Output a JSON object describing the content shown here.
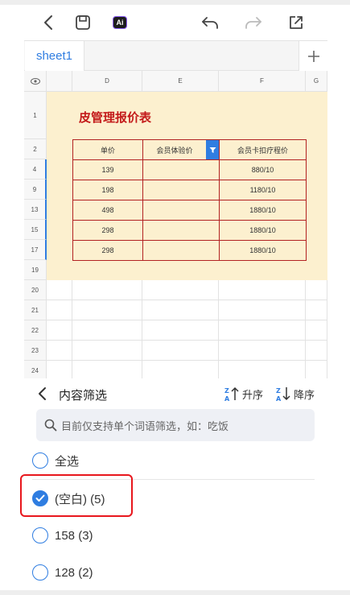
{
  "sheet_tab": "sheet1",
  "columns": [
    "D",
    "E",
    "F",
    "G"
  ],
  "rows_top": [
    "1",
    "2",
    "4",
    "9",
    "13",
    "15",
    "17",
    "19"
  ],
  "rows_empty": [
    "20",
    "21",
    "22",
    "23",
    "24"
  ],
  "table": {
    "title": "皮管理报价表",
    "headers": [
      "单价",
      "会员体验价",
      "会员卡扣疗程价"
    ],
    "data": [
      [
        "139",
        "",
        "880/10"
      ],
      [
        "198",
        "",
        "1180/10"
      ],
      [
        "498",
        "",
        "1880/10"
      ],
      [
        "298",
        "",
        "1880/10"
      ],
      [
        "298",
        "",
        "1880/10"
      ]
    ]
  },
  "toolbar": {
    "ai_label": "Ai"
  },
  "filter_panel": {
    "title": "内容筛选",
    "sort_asc": "升序",
    "sort_desc": "降序",
    "search_placeholder": "目前仅支持单个词语筛选，如：吃饭",
    "options": [
      {
        "label": "全选",
        "checked": false
      },
      {
        "label": "(空白) (5)",
        "checked": true
      },
      {
        "label": "158 (3)",
        "checked": false
      },
      {
        "label": "128 (2)",
        "checked": false
      }
    ]
  },
  "colors": {
    "accent": "#2f7de1",
    "table_fill": "#fcf0cf",
    "table_border": "#b22222",
    "title_red": "#c31a1a",
    "highlight": "#e8171d"
  }
}
